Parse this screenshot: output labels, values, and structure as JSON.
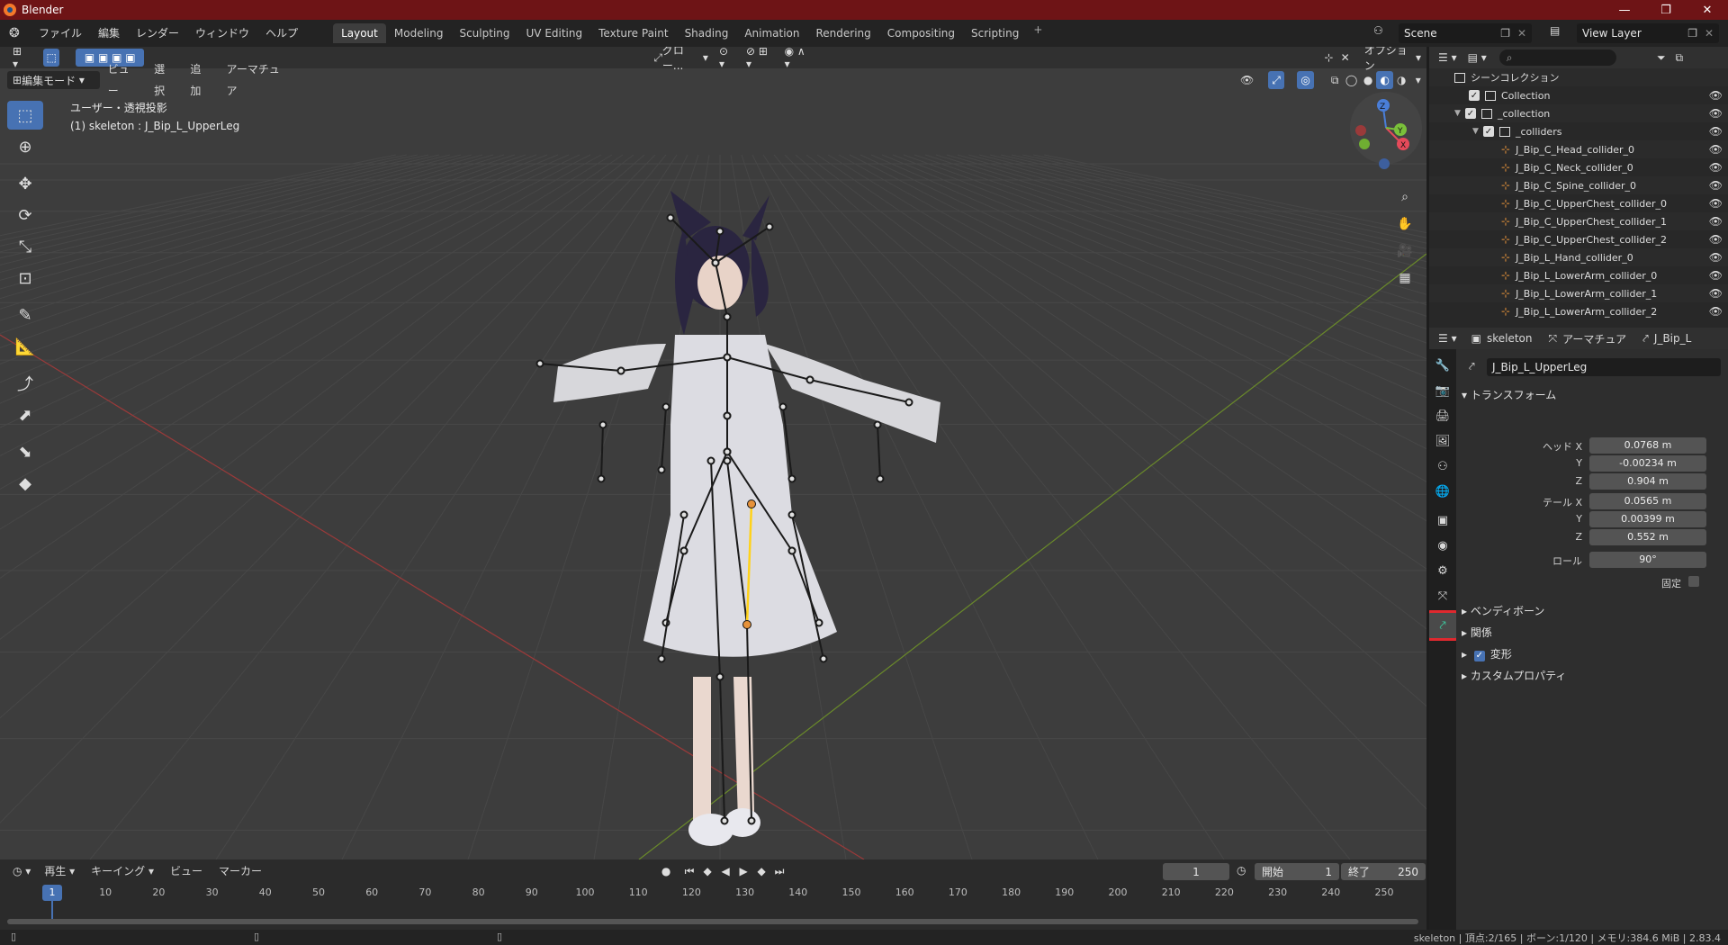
{
  "window": {
    "title": "Blender",
    "min": "—",
    "max": "❐",
    "close": "✕"
  },
  "menu": {
    "file": "ファイル",
    "edit": "編集",
    "render": "レンダー",
    "window": "ウィンドウ",
    "help": "ヘルプ"
  },
  "workspaces": [
    "Layout",
    "Modeling",
    "Sculpting",
    "UV Editing",
    "Texture Paint",
    "Shading",
    "Animation",
    "Rendering",
    "Compositing",
    "Scripting"
  ],
  "workspace_add": "+",
  "scene": {
    "name": "Scene",
    "view_layer": "View Layer"
  },
  "viewport": {
    "mode": "編集モード",
    "menus": {
      "view": "ビュー",
      "select": "選択",
      "add": "追加",
      "armature": "アーマチュア"
    },
    "orientation": "グロー...",
    "options": "オプション",
    "view_label": "ユーザー・透視投影",
    "object_label": "(1) skeleton : J_Bip_L_UpperLeg",
    "axis": {
      "x": "X",
      "y": "Y",
      "z": "Z"
    }
  },
  "timeline": {
    "playback": "再生",
    "keying": "キーイング",
    "view": "ビュー",
    "marker": "マーカー",
    "current_frame": "1",
    "start_label": "開始",
    "start": "1",
    "end_label": "終了",
    "end": "250",
    "ticks": [
      "10",
      "20",
      "30",
      "40",
      "50",
      "60",
      "70",
      "80",
      "90",
      "100",
      "110",
      "120",
      "130",
      "140",
      "150",
      "160",
      "170",
      "180",
      "190",
      "200",
      "210",
      "220",
      "230",
      "240",
      "250"
    ],
    "cursor": "1"
  },
  "status": {
    "text": "skeleton | 頂点:2/165 | ボーン:1/120 | メモリ:384.6 MiB | 2.83.4"
  },
  "outliner": {
    "root": "シーンコレクション",
    "rows": [
      {
        "label": "Collection"
      },
      {
        "label": "_collection"
      },
      {
        "label": "_colliders"
      },
      {
        "label": "J_Bip_C_Head_collider_0"
      },
      {
        "label": "J_Bip_C_Neck_collider_0"
      },
      {
        "label": "J_Bip_C_Spine_collider_0"
      },
      {
        "label": "J_Bip_C_UpperChest_collider_0"
      },
      {
        "label": "J_Bip_C_UpperChest_collider_1"
      },
      {
        "label": "J_Bip_C_UpperChest_collider_2"
      },
      {
        "label": "J_Bip_L_Hand_collider_0"
      },
      {
        "label": "J_Bip_L_LowerArm_collider_0"
      },
      {
        "label": "J_Bip_L_LowerArm_collider_1"
      },
      {
        "label": "J_Bip_L_LowerArm_collider_2"
      }
    ]
  },
  "properties": {
    "breadcrumb": {
      "object": "skeleton",
      "armature": "アーマチュア",
      "bone": "J_Bip_L"
    },
    "bone_name": "J_Bip_L_UpperLeg",
    "transform": {
      "title": "トランスフォーム",
      "head_label": "ヘッド X",
      "head_x": "0.0768 m",
      "y_label": "Y",
      "head_y": "-0.00234 m",
      "z_label": "Z",
      "head_z": "0.904 m",
      "tail_label": "テール X",
      "tail_x": "0.0565 m",
      "tail_y": "0.00399 m",
      "tail_z": "0.552 m",
      "roll_label": "ロール",
      "roll": "90°",
      "lock_label": "固定"
    },
    "panels": {
      "bendy": "ベンディボーン",
      "relations": "関係",
      "deform": "変形",
      "custom": "カスタムプロパティ"
    }
  },
  "colors": {
    "accent": "#4772b3",
    "titlebar": "#6e1416",
    "bone_selected": "#e6923a",
    "highlight": "#e0282e"
  }
}
